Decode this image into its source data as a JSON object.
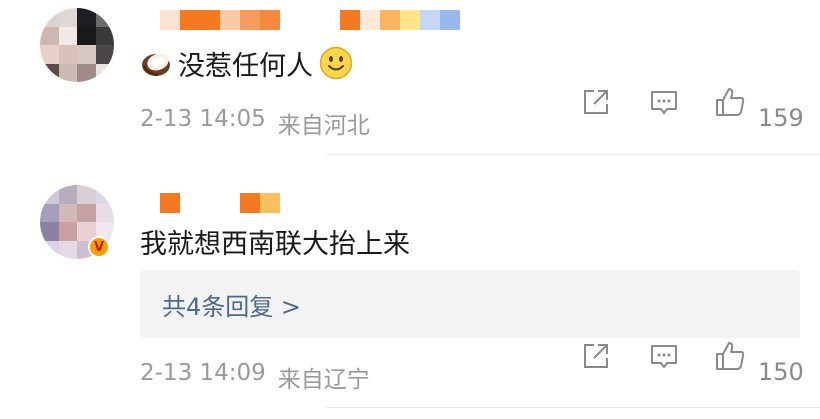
{
  "comments": [
    {
      "username_masked": true,
      "text": "没惹任何人",
      "emoji_prefix": "coconut-emoji",
      "emoji_suffix": "smile-emoji",
      "date": "2-13 14:05",
      "location": "来自河北",
      "like_count": "159",
      "verified": false
    },
    {
      "username_masked": true,
      "text": "我就想西南联大抬上来",
      "replies_label": "共4条回复 >",
      "date": "2-13 14:09",
      "location": "来自辽宁",
      "like_count": "150",
      "verified": true,
      "verified_badge": "V"
    }
  ],
  "icons": {
    "share": "share-icon",
    "comment": "comment-icon",
    "like": "like-icon"
  },
  "colors": {
    "reply_link": "#4a6a8e",
    "meta_text": "#9a9a9a",
    "like_count": "#8a8a8a",
    "verified_badge": "#f5a000"
  }
}
